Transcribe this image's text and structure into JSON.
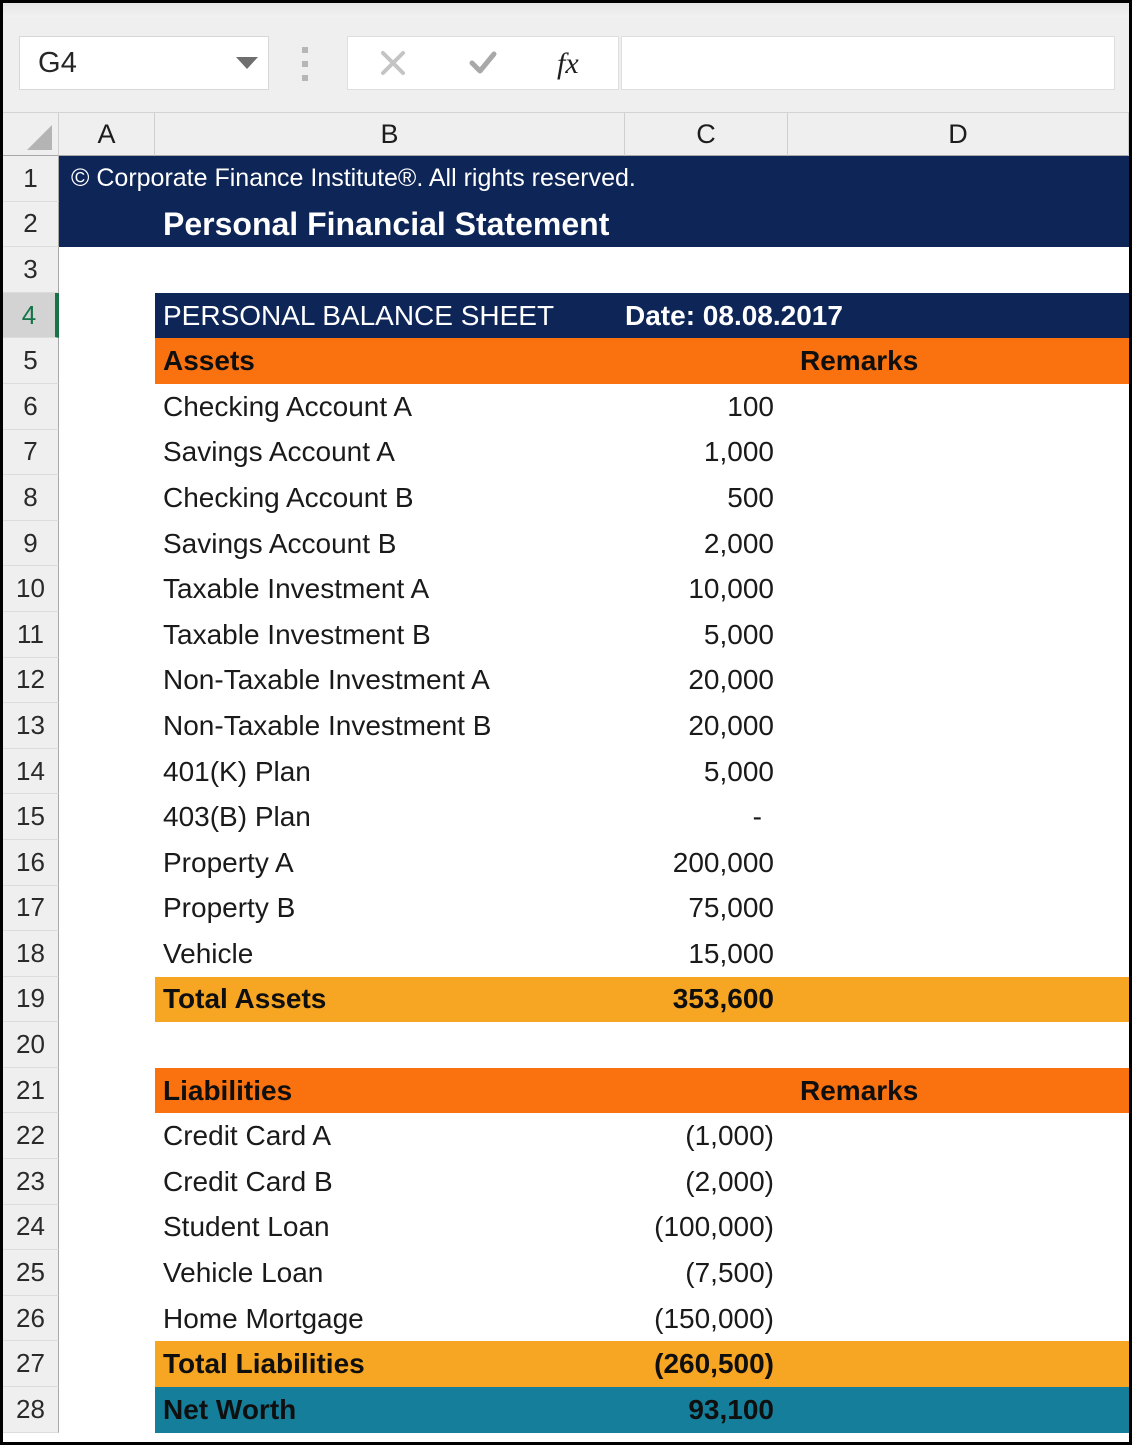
{
  "app": {
    "name_box_value": "G4",
    "formula_bar_value": "",
    "icons": {
      "name_box_dropdown": "chevron-down-icon",
      "more_options": "kebab-menu-icon",
      "cancel": "cancel-x-icon",
      "enter": "enter-check-icon",
      "insert_function": "fx-icon"
    }
  },
  "columns": [
    {
      "id": "A",
      "label": "A"
    },
    {
      "id": "B",
      "label": "B"
    },
    {
      "id": "C",
      "label": "C"
    },
    {
      "id": "D",
      "label": "D"
    }
  ],
  "active_row": 4,
  "colors": {
    "navy": "#0D2557",
    "orange": "#FA7210",
    "amber": "#F6A623",
    "teal": "#157F9B",
    "white": "#FFFFFF",
    "header_gray": "#EFEFEF",
    "active_row_green": "#157347"
  },
  "banner": {
    "copyright": "© Corporate Finance Institute®. All rights reserved.",
    "title": "Personal Financial Statement"
  },
  "sheet_title": {
    "label": "PERSONAL BALANCE SHEET",
    "date": "Date: 08.08.2017"
  },
  "assets_header": {
    "label": "Assets",
    "remarks": "Remarks"
  },
  "assets": [
    {
      "row": 6,
      "label": "Checking Account A",
      "value": "100",
      "remark": ""
    },
    {
      "row": 7,
      "label": "Savings Account A",
      "value": "1,000",
      "remark": ""
    },
    {
      "row": 8,
      "label": "Checking Account B",
      "value": "500",
      "remark": ""
    },
    {
      "row": 9,
      "label": "Savings Account B",
      "value": "2,000",
      "remark": ""
    },
    {
      "row": 10,
      "label": "Taxable Investment A",
      "value": "10,000",
      "remark": ""
    },
    {
      "row": 11,
      "label": "Taxable Investment B",
      "value": "5,000",
      "remark": ""
    },
    {
      "row": 12,
      "label": "Non-Taxable Investment A",
      "value": "20,000",
      "remark": ""
    },
    {
      "row": 13,
      "label": "Non-Taxable Investment B",
      "value": "20,000",
      "remark": ""
    },
    {
      "row": 14,
      "label": "401(K) Plan",
      "value": "5,000",
      "remark": ""
    },
    {
      "row": 15,
      "label": "403(B) Plan",
      "value": "-",
      "remark": ""
    },
    {
      "row": 16,
      "label": "Property A",
      "value": "200,000",
      "remark": ""
    },
    {
      "row": 17,
      "label": "Property B",
      "value": "75,000",
      "remark": ""
    },
    {
      "row": 18,
      "label": "Vehicle",
      "value": "15,000",
      "remark": ""
    }
  ],
  "total_assets": {
    "row": 19,
    "label": "Total Assets",
    "value": "353,600"
  },
  "blank_row": {
    "row": 20
  },
  "liabilities_header": {
    "row": 21,
    "label": "Liabilities",
    "remarks": "Remarks"
  },
  "liabilities": [
    {
      "row": 22,
      "label": "Credit Card A",
      "value": "(1,000)",
      "remark": ""
    },
    {
      "row": 23,
      "label": "Credit Card B",
      "value": "(2,000)",
      "remark": ""
    },
    {
      "row": 24,
      "label": "Student Loan",
      "value": "(100,000)",
      "remark": ""
    },
    {
      "row": 25,
      "label": "Vehicle Loan",
      "value": "(7,500)",
      "remark": ""
    },
    {
      "row": 26,
      "label": "Home Mortgage",
      "value": "(150,000)",
      "remark": ""
    }
  ],
  "total_liabilities": {
    "row": 27,
    "label": "Total Liabilities",
    "value": "(260,500)"
  },
  "net_worth": {
    "row": 28,
    "label": "Net Worth",
    "value": "93,100"
  }
}
